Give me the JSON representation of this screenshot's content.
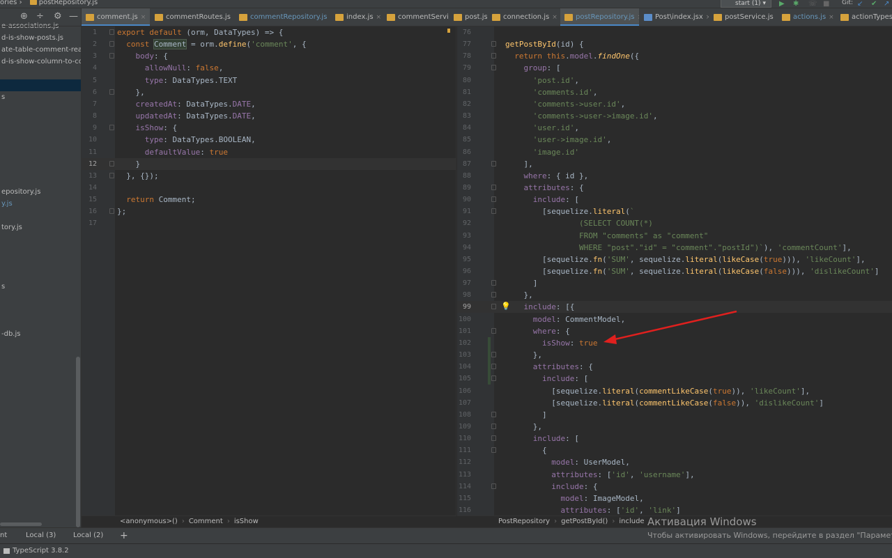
{
  "topbar": {
    "breadcrumb_prefix": "ories",
    "breadcrumb_sep": "›",
    "breadcrumb_file": "postRepository.js",
    "run_config": "start (1)",
    "git_label": "Git:"
  },
  "sidebar": {
    "items": [
      {
        "label": "e-associations.js"
      },
      {
        "label": "d-is-show-posts.js"
      },
      {
        "label": "ate-table-comment-reactio"
      },
      {
        "label": "d-is-show-column-to-com"
      },
      {
        "label": ""
      },
      {
        "label": ""
      },
      {
        "label": "s"
      },
      {
        "label": ""
      },
      {
        "label": ""
      },
      {
        "label": ""
      },
      {
        "label": ""
      },
      {
        "label": ""
      },
      {
        "label": ""
      },
      {
        "label": ""
      },
      {
        "label": "epository.js"
      },
      {
        "label": "y.js"
      },
      {
        "label": ""
      },
      {
        "label": "tory.js"
      },
      {
        "label": ""
      },
      {
        "label": ""
      },
      {
        "label": ""
      },
      {
        "label": ""
      },
      {
        "label": "s"
      },
      {
        "label": ""
      },
      {
        "label": ""
      },
      {
        "label": ""
      },
      {
        "label": "-db.js"
      }
    ]
  },
  "tabs": [
    {
      "label": "comment.js",
      "active": true,
      "jsx": false
    },
    {
      "label": "commentRoutes.js",
      "jsx": false
    },
    {
      "label": "commentRepository.js",
      "blue": true,
      "jsx": false
    },
    {
      "label": "index.js",
      "jsx": false
    },
    {
      "label": "commentServic",
      "jsx": false
    },
    {
      "label": "post.js",
      "jsx": false
    },
    {
      "label": "connection.js",
      "jsx": false
    },
    {
      "label": "postRepository.js",
      "active": true,
      "blue": true,
      "jsx": false
    },
    {
      "label": "Post\\index.jsx",
      "jsx": true
    },
    {
      "label": "postService.js",
      "jsx": false
    },
    {
      "label": "actions.js",
      "blue": true,
      "jsx": false
    },
    {
      "label": "actionTypes.js",
      "jsx": false
    }
  ],
  "left_editor": {
    "current_line": 12,
    "lines": [
      {
        "n": "1",
        "html": "<span class=\"kw\">export default</span> (orm, DataTypes) => {"
      },
      {
        "n": "2",
        "html": "  <span class=\"kw\">const</span> <span class=\"hl\">Comment</span> = orm.<span class=\"fn\">define</span>(<span class=\"str\">'comment'</span>, {"
      },
      {
        "n": "3",
        "html": "    <span class=\"prop\">body</span>: {"
      },
      {
        "n": "4",
        "html": "      <span class=\"prop\">allowNull</span>: <span class=\"kw\">false</span>,"
      },
      {
        "n": "5",
        "html": "      <span class=\"prop\">type</span>: DataTypes.TEXT"
      },
      {
        "n": "6",
        "html": "    },"
      },
      {
        "n": "7",
        "html": "    <span class=\"prop\">createdAt</span>: DataTypes.<span class=\"prop\">DATE</span>,"
      },
      {
        "n": "8",
        "html": "    <span class=\"prop\">updatedAt</span>: DataTypes.<span class=\"prop\">DATE</span>,"
      },
      {
        "n": "9",
        "html": "    <span class=\"prop\">isShow</span>: {"
      },
      {
        "n": "10",
        "html": "      <span class=\"prop\">type</span>: DataTypes.BOOLEAN,"
      },
      {
        "n": "11",
        "html": "      <span class=\"prop\">defaultValue</span>: <span class=\"kw\">true</span>"
      },
      {
        "n": "12",
        "html": "    }"
      },
      {
        "n": "13",
        "html": "  }, {});"
      },
      {
        "n": "14",
        "html": ""
      },
      {
        "n": "15",
        "html": "  <span class=\"kw\">return</span> Comment;"
      },
      {
        "n": "16",
        "html": "};"
      },
      {
        "n": "17",
        "html": ""
      }
    ]
  },
  "right_editor": {
    "current_line": 99,
    "lines": [
      {
        "n": "76",
        "html": ""
      },
      {
        "n": "77",
        "html": "<span class=\"fn\">getPostById</span>(id) {"
      },
      {
        "n": "78",
        "html": "  <span class=\"kw\">return this</span>.<span class=\"prop\">model</span>.<span class=\"fni\">findOne</span>({"
      },
      {
        "n": "79",
        "html": "    <span class=\"prop\">group</span>: ["
      },
      {
        "n": "80",
        "html": "      <span class=\"str\">'post.id'</span>,"
      },
      {
        "n": "81",
        "html": "      <span class=\"str\">'comments.id'</span>,"
      },
      {
        "n": "82",
        "html": "      <span class=\"str\">'comments->user.id'</span>,"
      },
      {
        "n": "83",
        "html": "      <span class=\"str\">'comments->user->image.id'</span>,"
      },
      {
        "n": "84",
        "html": "      <span class=\"str\">'user.id'</span>,"
      },
      {
        "n": "85",
        "html": "      <span class=\"str\">'user->image.id'</span>,"
      },
      {
        "n": "86",
        "html": "      <span class=\"str\">'image.id'</span>"
      },
      {
        "n": "87",
        "html": "    ],"
      },
      {
        "n": "88",
        "html": "    <span class=\"prop\">where</span>: { id },"
      },
      {
        "n": "89",
        "html": "    <span class=\"prop\">attributes</span>: {"
      },
      {
        "n": "90",
        "html": "      <span class=\"prop\">include</span>: ["
      },
      {
        "n": "91",
        "html": "        [sequelize.<span class=\"fn\">literal</span>(<span class=\"tpl\">`</span>"
      },
      {
        "n": "92",
        "html": "<span class=\"tpl\">                (SELECT COUNT(*)</span>"
      },
      {
        "n": "93",
        "html": "<span class=\"tpl\">                FROM \"comments\" as \"comment\"</span>"
      },
      {
        "n": "94",
        "html": "<span class=\"tpl\">                WHERE \"post\".\"id\" = \"comment\".\"postId\")`</span>), <span class=\"str\">'commentCount'</span>],"
      },
      {
        "n": "95",
        "html": "        [sequelize.<span class=\"fn\">fn</span>(<span class=\"str\">'SUM'</span>, sequelize.<span class=\"fn\">literal</span>(<span class=\"fn\">likeCase</span>(<span class=\"kw\">true</span>))), <span class=\"str\">'likeCount'</span>],"
      },
      {
        "n": "96",
        "html": "        [sequelize.<span class=\"fn\">fn</span>(<span class=\"str\">'SUM'</span>, sequelize.<span class=\"fn\">literal</span>(<span class=\"fn\">likeCase</span>(<span class=\"kw\">false</span>))), <span class=\"str\">'dislikeCount'</span>]"
      },
      {
        "n": "97",
        "html": "      ]"
      },
      {
        "n": "98",
        "html": "    },"
      },
      {
        "n": "99",
        "html": "    <span class=\"prop\">include</span>: [{"
      },
      {
        "n": "100",
        "html": "      <span class=\"prop\">model</span>: CommentModel,"
      },
      {
        "n": "101",
        "html": "      <span class=\"prop\">where</span>: {"
      },
      {
        "n": "102",
        "html": "        <span class=\"prop\">isShow</span>: <span class=\"kw\">true</span>"
      },
      {
        "n": "103",
        "html": "      },"
      },
      {
        "n": "104",
        "html": "      <span class=\"prop\">attributes</span>: {"
      },
      {
        "n": "105",
        "html": "        <span class=\"prop\">include</span>: ["
      },
      {
        "n": "106",
        "html": "          [sequelize.<span class=\"fn\">literal</span>(<span class=\"fn\">commentLikeCase</span>(<span class=\"kw\">true</span>)), <span class=\"str\">'likeCount'</span>],"
      },
      {
        "n": "107",
        "html": "          [sequelize.<span class=\"fn\">literal</span>(<span class=\"fn\">commentLikeCase</span>(<span class=\"kw\">false</span>)), <span class=\"str\">'dislikeCount'</span>]"
      },
      {
        "n": "108",
        "html": "        ]"
      },
      {
        "n": "109",
        "html": "      },"
      },
      {
        "n": "110",
        "html": "      <span class=\"prop\">include</span>: ["
      },
      {
        "n": "111",
        "html": "        {"
      },
      {
        "n": "112",
        "html": "          <span class=\"prop\">model</span>: UserModel,"
      },
      {
        "n": "113",
        "html": "          <span class=\"prop\">attributes</span>: [<span class=\"str\">'id'</span>, <span class=\"str\">'username'</span>],"
      },
      {
        "n": "114",
        "html": "          <span class=\"prop\">include</span>: {"
      },
      {
        "n": "115",
        "html": "            <span class=\"prop\">model</span>: ImageModel,"
      },
      {
        "n": "116",
        "html": "            <span class=\"prop\">attributes</span>: [<span class=\"str\">'id'</span>, <span class=\"str\">'link'</span>]"
      }
    ]
  },
  "left_status": [
    "<anonymous>()",
    "Comment",
    "isShow"
  ],
  "right_status": [
    "PostRepository",
    "getPostById()",
    "include"
  ],
  "terminal_tabs": [
    "nt",
    "Local (3)",
    "Local (2)",
    "+"
  ],
  "statusbar": {
    "typescript": "TypeScript 3.8.2"
  },
  "watermark": {
    "title": "Активация Windows",
    "subtitle": "Чтобы активировать Windows, перейдите в раздел \"Параметры\""
  },
  "colors": {
    "accent": "#4a88c7",
    "arrow": "#e0201e",
    "keyword": "#cc7832",
    "string": "#6a8759"
  }
}
